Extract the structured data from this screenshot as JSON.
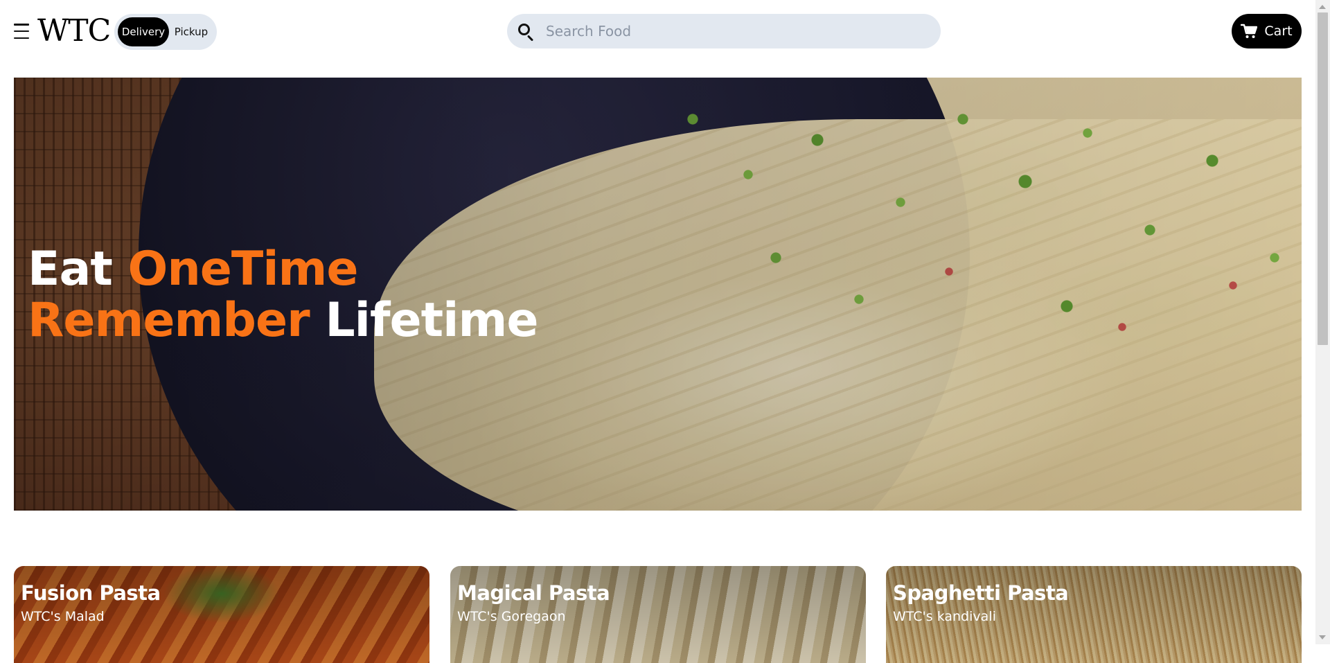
{
  "header": {
    "logo": "WTC",
    "mode_toggle": {
      "delivery_label": "Delivery",
      "pickup_label": "Pickup",
      "selected": "Delivery"
    },
    "search": {
      "placeholder": "Search Food",
      "value": ""
    },
    "cart_label": "Cart"
  },
  "hero": {
    "line1_word1": "Eat",
    "line1_word2": "OneTime",
    "line2_word1": "Remember",
    "line2_word2": "Lifetime"
  },
  "cards": [
    {
      "title": "Fusion Pasta",
      "location": "WTC's Malad"
    },
    {
      "title": "Magical Pasta",
      "location": "WTC's Goregaon"
    },
    {
      "title": "Spaghetti Pasta",
      "location": "WTC's kandivali"
    }
  ],
  "colors": {
    "accent": "#f97316",
    "dark": "#000000",
    "pill_bg": "#e2e8f0"
  },
  "icons": {
    "menu": "hamburger-menu-icon",
    "search": "search-icon",
    "cart": "cart-icon"
  }
}
